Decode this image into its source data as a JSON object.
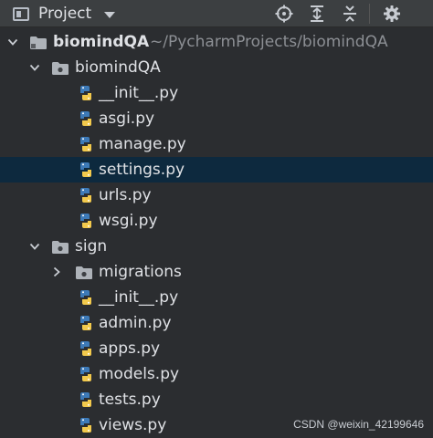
{
  "toolbar": {
    "title": "Project",
    "icons": [
      "locate-icon",
      "expand-all-icon",
      "collapse-all-icon",
      "gear-icon"
    ]
  },
  "tree": {
    "root": {
      "name": "biomindQA",
      "path": "~/PycharmProjects/biomindQA"
    },
    "biomindqa_pkg": {
      "name": "biomindQA",
      "files": [
        "__init__.py",
        "asgi.py",
        "manage.py",
        "settings.py",
        "urls.py",
        "wsgi.py"
      ]
    },
    "sign_pkg": {
      "name": "sign",
      "migrations": "migrations",
      "files": [
        "__init__.py",
        "admin.py",
        "apps.py",
        "models.py",
        "tests.py",
        "views.py"
      ]
    },
    "selected": "settings.py"
  },
  "watermark": "CSDN @weixin_42199646",
  "colors": {
    "background": "#2b2d30",
    "toolbar": "#3c3f41",
    "selection": "#0d293e",
    "python_blue": "#3d7ab8",
    "python_yellow": "#f2c94c"
  }
}
